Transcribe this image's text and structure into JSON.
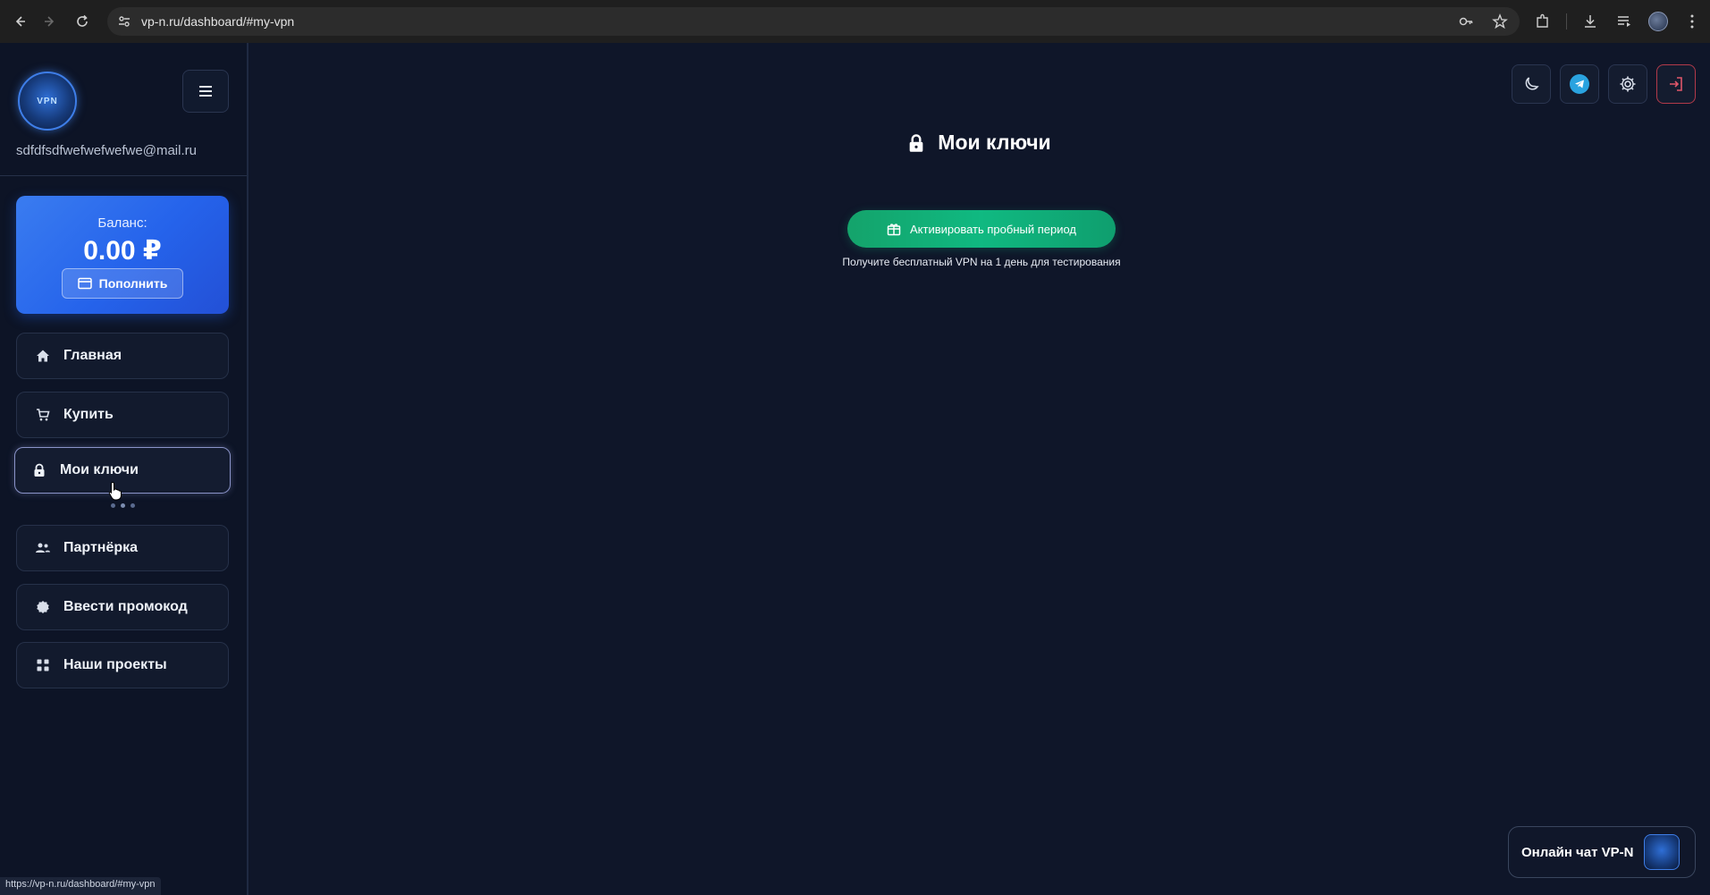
{
  "browser": {
    "url": "vp-n.ru/dashboard/#my-vpn",
    "status_url": "https://vp-n.ru/dashboard/#my-vpn"
  },
  "sidebar": {
    "logo_text": "VPN",
    "email": "sdfdfsdfwefwefwefwe@mail.ru",
    "balance": {
      "label": "Баланс:",
      "amount": "0.00 ₽",
      "topup_label": "Пополнить"
    },
    "items": [
      {
        "label": "Главная",
        "icon": "home-icon"
      },
      {
        "label": "Купить",
        "icon": "cart-icon"
      },
      {
        "label": "Мои ключи",
        "icon": "lock-icon",
        "active": true
      },
      {
        "label": "Партнёрка",
        "icon": "users-icon"
      },
      {
        "label": "Ввести промокод",
        "icon": "badge-icon"
      },
      {
        "label": "Наши проекты",
        "icon": "grid-icon"
      }
    ]
  },
  "main": {
    "title": "Мои ключи",
    "trial_button_label": "Активировать пробный период",
    "trial_note": "Получите бесплатный VPN на 1 день для тестирования"
  },
  "chat": {
    "label": "Онлайн чат VP-N"
  },
  "colors": {
    "background": "#0f1629",
    "accent_blue": "#2563eb",
    "accent_green": "#10b981",
    "logout_border": "#b33a4a"
  }
}
